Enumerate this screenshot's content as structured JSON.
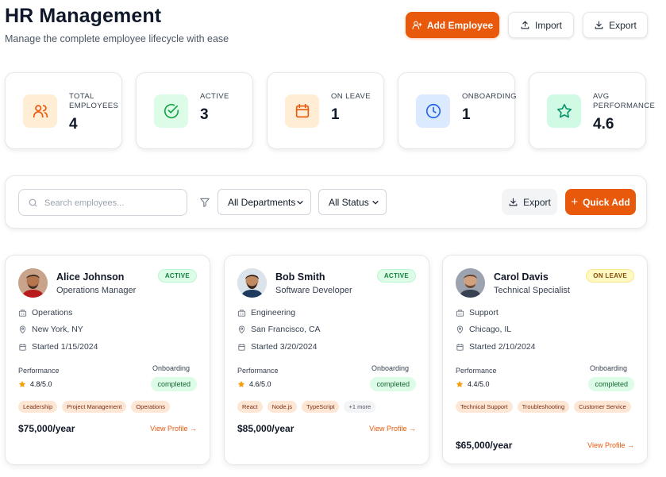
{
  "header": {
    "title": "HR Management",
    "subtitle": "Manage the complete employee lifecycle with ease",
    "add_label": "Add Employee",
    "import_label": "Import",
    "export_label": "Export"
  },
  "stats": [
    {
      "label": "Total Employees",
      "value": "4",
      "icon": "users-icon",
      "color": "#ea580c",
      "bg": "#ffedd5"
    },
    {
      "label": "Active",
      "value": "3",
      "icon": "check-circle-icon",
      "color": "#16a34a",
      "bg": "#dcfce7"
    },
    {
      "label": "On Leave",
      "value": "1",
      "icon": "calendar-icon",
      "color": "#ea580c",
      "bg": "#ffedd5"
    },
    {
      "label": "Onboarding",
      "value": "1",
      "icon": "clock-icon",
      "color": "#2563eb",
      "bg": "#dbeafe"
    },
    {
      "label": "Avg Performance",
      "value": "4.6",
      "icon": "star-icon",
      "color": "#059669",
      "bg": "#d1fae5"
    }
  ],
  "filters": {
    "search_placeholder": "Search employees...",
    "department": "All Departments",
    "status": "All Status",
    "export_label": "Export",
    "quick_add_label": "Quick Add"
  },
  "employees": [
    {
      "name": "Alice Johnson",
      "role": "Operations Manager",
      "status": "ACTIVE",
      "department": "Operations",
      "location": "New York, NY",
      "started": "Started 1/15/2024",
      "perf_label": "Performance",
      "rating": "4.8/5.0",
      "onb_label": "Onboarding",
      "onb_status": "completed",
      "skills": [
        "Leadership",
        "Project Management",
        "Operations"
      ],
      "salary": "$75,000/year",
      "link": "View Profile →"
    },
    {
      "name": "Bob Smith",
      "role": "Software Developer",
      "status": "ACTIVE",
      "department": "Engineering",
      "location": "San Francisco, CA",
      "started": "Started 3/20/2024",
      "perf_label": "Performance",
      "rating": "4.6/5.0",
      "onb_label": "Onboarding",
      "onb_status": "completed",
      "skills": [
        "React",
        "Node.js",
        "TypeScript",
        "+1 more"
      ],
      "salary": "$85,000/year",
      "link": "View Profile →"
    },
    {
      "name": "Carol Davis",
      "role": "Technical Specialist",
      "status": "ON LEAVE",
      "department": "Support",
      "location": "Chicago, IL",
      "started": "Started 2/10/2024",
      "perf_label": "Performance",
      "rating": "4.4/5.0",
      "onb_label": "Onboarding",
      "onb_status": "completed",
      "skills": [
        "Technical Support",
        "Troubleshooting",
        "Customer Service"
      ],
      "salary": "$65,000/year",
      "link": "View Profile →"
    }
  ],
  "colors": {
    "accent": "#e8590c",
    "star": "#f59e0b"
  }
}
